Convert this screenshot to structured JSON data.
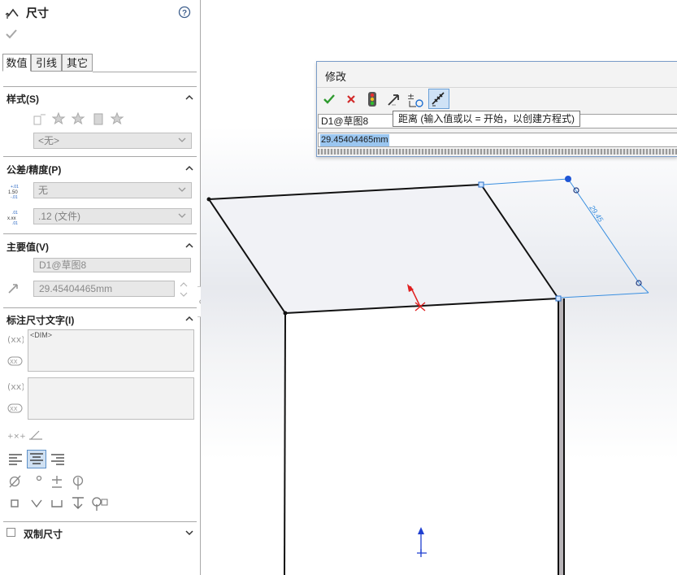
{
  "panel": {
    "title": "尺寸",
    "help_icon": "question-circle-icon",
    "tabs": [
      {
        "label": "数值"
      },
      {
        "label": "引线"
      },
      {
        "label": "其它"
      }
    ],
    "style_section": {
      "title": "样式(S)",
      "dropdown": "<无>"
    },
    "tolerance_section": {
      "title": "公差/精度(P)",
      "tolerance_value": "无",
      "precision_value": ".12 (文件)"
    },
    "primary_section": {
      "title": "主要值(V)",
      "name_value": "D1@草图8",
      "value": "29.45404465mm"
    },
    "dimtext_section": {
      "title": "标注尺寸文字(I)",
      "dim_token": "<DIM>"
    },
    "dual_section": {
      "title": "双制尺寸"
    }
  },
  "modify_dialog": {
    "title": "修改",
    "name_field": "D1@草图8",
    "value_field": "29.45404465mm",
    "tooltip": "距离  (输入值或以 = 开始，以创建方程式)"
  },
  "viewport": {
    "dimension_label": "29.45",
    "colors": {
      "dimension": "#3a8fe0",
      "edge": "#111111",
      "arrow": "#e02020",
      "axis": "#1f3fd0"
    }
  }
}
